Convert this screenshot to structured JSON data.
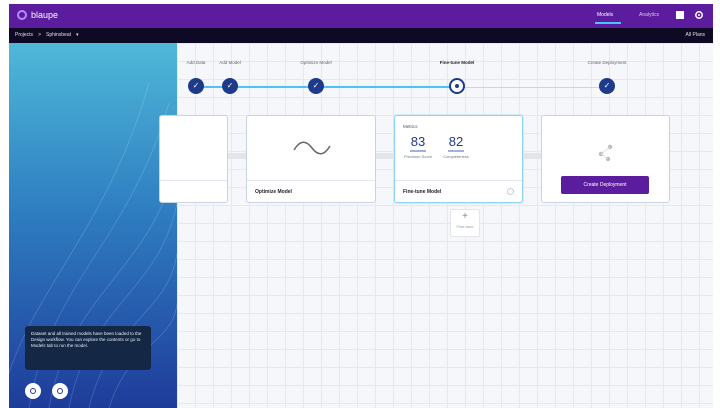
{
  "app": {
    "name": "blaupe",
    "tabs": [
      "Models",
      "Analytics"
    ],
    "active_tab": 0
  },
  "subbar": {
    "breadcrumb": [
      "Projects",
      ">",
      "Sphinxbeat",
      "▾"
    ],
    "right_text": "All Plans"
  },
  "icons": {
    "logo": "blaupe-logo-icon",
    "help": "help-icon",
    "settings": "gear-icon",
    "check": "check-icon",
    "wave": "sine-wave-icon",
    "deploy": "deploy-nodes-icon",
    "plus": "plus-icon"
  },
  "sidebar": {
    "tooltip": "Dataset and all trained models have been loaded to the Design workflow. You can explore the contents or go to Models tab to run the model.",
    "buttons": [
      "settings",
      "refresh"
    ]
  },
  "steps": [
    {
      "label": "Add Data",
      "state": "done"
    },
    {
      "label": "Add Model",
      "state": "done"
    },
    {
      "label": "Optimize Model",
      "state": "done"
    },
    {
      "label": "Fine-tune Model",
      "state": "current"
    },
    {
      "label": "Create Deployment",
      "state": "done"
    }
  ],
  "cards": {
    "optimize": {
      "title": "Optimize Model"
    },
    "finetune": {
      "title": "Fine-tune Model",
      "section": "Metrics",
      "metrics": [
        {
          "value": "83",
          "label": "Precision Score"
        },
        {
          "value": "82",
          "label": "Completeness"
        }
      ]
    },
    "deploy": {
      "button": "Create Deployment"
    }
  },
  "add_node": {
    "label": "Fine-tune"
  },
  "colors": {
    "brand": "#5b1c9e",
    "step": "#1e3a8a",
    "tab_underline": "#4fc3f7"
  }
}
